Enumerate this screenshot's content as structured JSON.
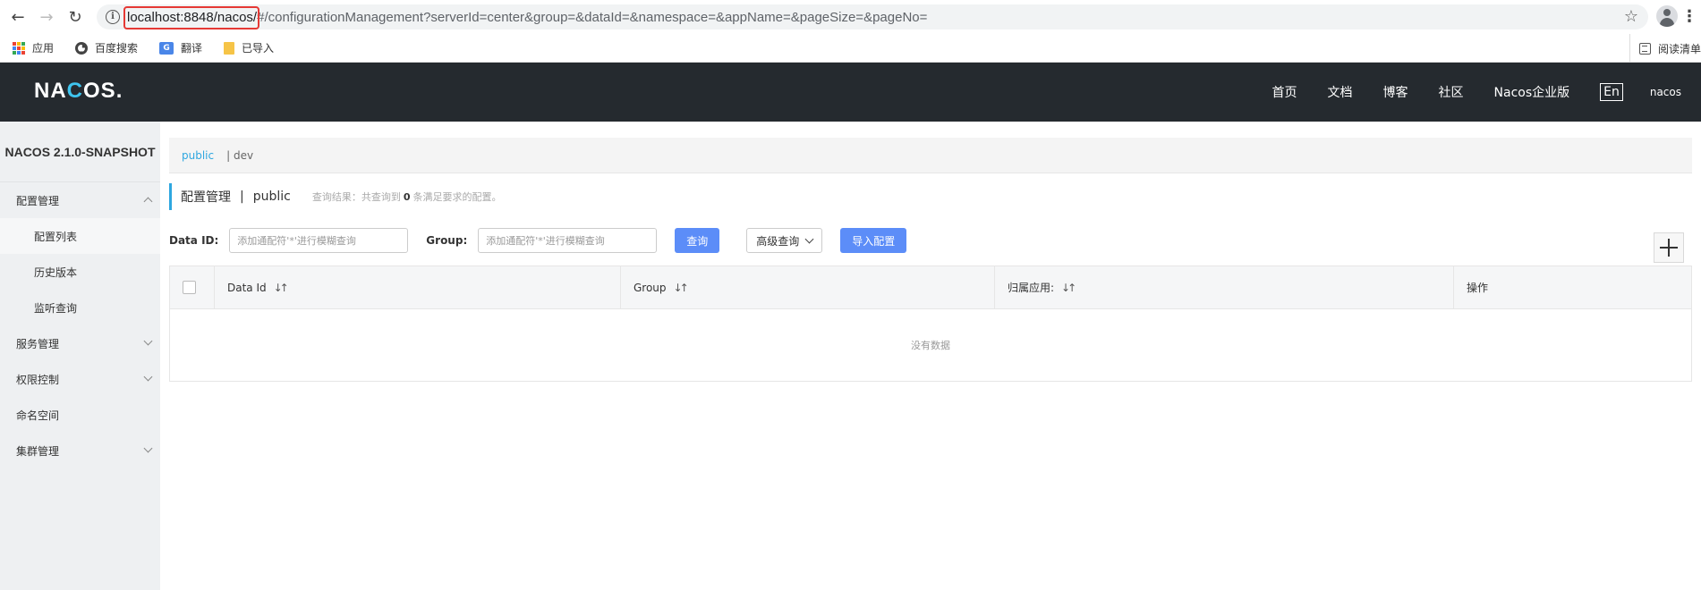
{
  "browser": {
    "url_host": "localhost:8848/nacos/",
    "url_rest": "#/configurationManagement?serverId=center&group=&dataId=&namespace=&appName=&pageSize=&pageNo=",
    "bookmarks": [
      {
        "label": "应用"
      },
      {
        "label": "百度搜索"
      },
      {
        "label": "翻译"
      },
      {
        "label": "已导入"
      }
    ],
    "reading_list": "阅读清单"
  },
  "header": {
    "logo": {
      "left": "NA",
      "mid": "C",
      "right": "OS."
    },
    "nav": [
      "首页",
      "文档",
      "博客",
      "社区",
      "Nacos企业版"
    ],
    "lang": "En",
    "user": "nacos"
  },
  "sidebar": {
    "title": "NACOS 2.1.0-SNAPSHOT",
    "items": [
      {
        "label": "配置管理",
        "expanded": true
      },
      {
        "label": "配置列表",
        "sub": true,
        "active": true
      },
      {
        "label": "历史版本",
        "sub": true
      },
      {
        "label": "监听查询",
        "sub": true
      },
      {
        "label": "服务管理",
        "expanded": false
      },
      {
        "label": "权限控制",
        "expanded": false
      },
      {
        "label": "命名空间"
      },
      {
        "label": "集群管理",
        "expanded": false
      }
    ]
  },
  "namespaces": {
    "active": "public",
    "other": "| dev"
  },
  "breadcrumb": {
    "title": "配置管理",
    "sep": "|",
    "namespace": "public",
    "result_prefix": "查询结果：共查询到",
    "result_count": "0",
    "result_suffix": "条满足要求的配置。"
  },
  "search": {
    "dataid_label": "Data ID:",
    "dataid_placeholder": "添加通配符'*'进行模糊查询",
    "group_label": "Group:",
    "group_placeholder": "添加通配符'*'进行模糊查询",
    "query_button": "查询",
    "advanced_button": "高级查询",
    "import_button": "导入配置"
  },
  "table": {
    "columns": [
      "Data Id",
      "Group",
      "归属应用:",
      "操作"
    ],
    "empty_text": "没有数据"
  },
  "colors": {
    "accent": "#2ea7e0",
    "primary_button": "#5c8df8",
    "header_bg": "#252a2f",
    "highlight": "#e53935"
  }
}
